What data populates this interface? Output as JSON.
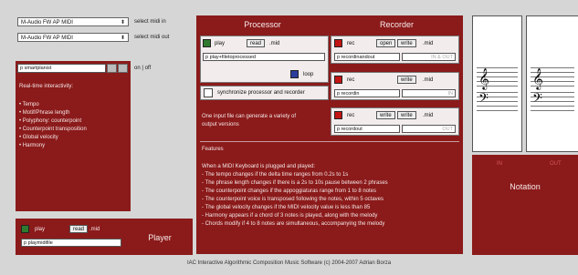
{
  "left": {
    "midi_in_device": "M-Audio FW AP MIDI",
    "midi_in_label": "select midi in",
    "midi_out_device": "M-Audio FW AP MIDI",
    "midi_out_label": "select midi out",
    "planist_field": "p smartplanist",
    "onoff_label": "on | off",
    "interactivity_title": "Real-time interactivity:",
    "interactivity_items": [
      "• Tempo",
      "• Motif/Phrase length",
      "• Polyphony: counterpoint",
      "• Counterpoint transposition",
      "• Global velocity",
      "• Harmony"
    ]
  },
  "player": {
    "play_label": "play",
    "read_label": "read",
    "ext_label": ".mid",
    "file_field": "p playmidifile",
    "title": "Player"
  },
  "processor": {
    "title": "Processor",
    "play_label": "play",
    "read_label": "read",
    "ext_label": ".mid",
    "file_field": "p play+filetoprocessed",
    "loop_label": "loop",
    "sync_label": "synchronize processor and recorder",
    "note": "One input file can generate a variety of output versions"
  },
  "recorder": {
    "title": "Recorder",
    "row1": {
      "rec": "rec",
      "open": "open",
      "write": "write",
      "ext": ".mid",
      "field": "p recordinandout",
      "status": "IN & OUT"
    },
    "row2": {
      "rec": "rec",
      "write": "write",
      "ext": ".mid",
      "field": "p recordin",
      "status": "IN"
    },
    "row3": {
      "rec": "rec",
      "write1": "write",
      "write2": "write",
      "ext": ".mid",
      "field": "p recordout",
      "status": "OUT"
    }
  },
  "features": {
    "title": "Features",
    "intro": "When a MIDI Keyboard is plugged and played:",
    "items": [
      "- The tempo changes if the delta time ranges from 0.2s to 1s",
      "- The phrase length changes if there is a 2s to 10s pause between 2 phrases",
      "- The counterpoint changes if the appoggiaturas range from 1 to 8 notes",
      "- The counterpoint voice is transposed following the notes, within 5 octaves",
      "- The global velocity changes if the MIDI velocity value is less than 85",
      "- Harmony appears if a chord of 3 notes is played, along with the melody",
      "- Chords modify if 4 to 8 notes are simultaneous, accompanying the melody"
    ]
  },
  "notation": {
    "in_label": "IN",
    "out_label": "OUT",
    "title": "Notation",
    "treble_glyph": "𝄞",
    "bass_glyph": "𝄢"
  },
  "footer": "IAC Interactive Algorithmic Composition Music Software (c) 2004-2007 Adrian Borza",
  "colors": {
    "panel": "#8b1a1a",
    "background": "#d6d6d6",
    "rec": "#c21515",
    "play": "#2f7a2f",
    "loop": "#2a3d9c"
  }
}
